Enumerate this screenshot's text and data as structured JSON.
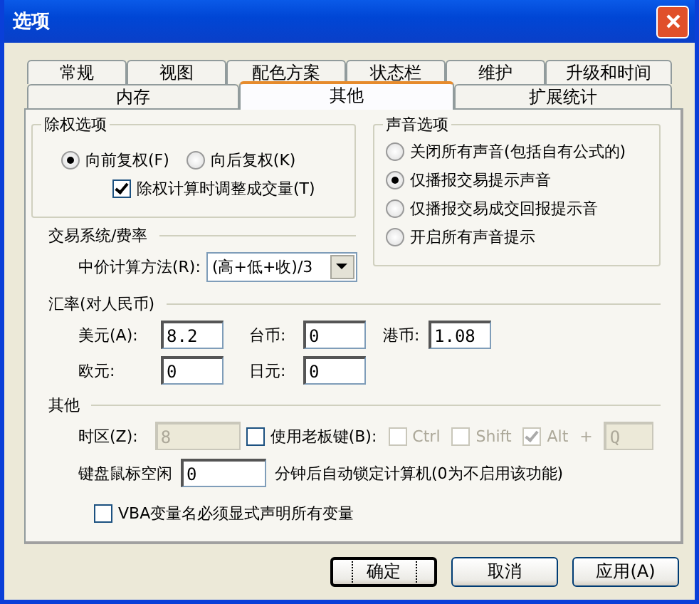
{
  "window": {
    "title": "选项"
  },
  "tab_rows": [
    [
      {
        "label": "常规",
        "selected": false
      },
      {
        "label": "视图",
        "selected": false
      },
      {
        "label": "配色方案",
        "selected": false
      },
      {
        "label": "状态栏",
        "selected": false
      },
      {
        "label": "维护",
        "selected": false
      },
      {
        "label": "升级和时间",
        "selected": false
      }
    ],
    [
      {
        "label": "内存",
        "selected": false
      },
      {
        "label": "其他",
        "selected": true
      },
      {
        "label": "扩展统计",
        "selected": false
      }
    ]
  ],
  "adjust_group": {
    "title": "除权选项",
    "radios": [
      {
        "label": "向前复权(F)",
        "selected": true
      },
      {
        "label": "向后复权(K)",
        "selected": false
      }
    ],
    "checkbox": {
      "label": "除权计算时调整成交量(T)",
      "checked": true
    }
  },
  "sound_group": {
    "title": "声音选项",
    "radios": [
      {
        "label": "关闭所有声音(包括自有公式的)",
        "selected": false
      },
      {
        "label": "仅播报交易提示声音",
        "selected": true
      },
      {
        "label": "仅播报交易成交回报提示音",
        "selected": false
      },
      {
        "label": "开启所有声音提示",
        "selected": false
      }
    ]
  },
  "trading": {
    "title": "交易系统/费率",
    "field_label": "中价计算方法(R):",
    "dropdown_value": "(高+低+收)/3"
  },
  "exchange": {
    "title": "汇率(对人民币)",
    "fields": [
      {
        "label": "美元(A):",
        "value": "8.2"
      },
      {
        "label": "台币:",
        "value": "0"
      },
      {
        "label": "港币:",
        "value": "1.08"
      },
      {
        "label": "欧元:",
        "value": "0"
      },
      {
        "label": "日元:",
        "value": "0"
      }
    ]
  },
  "other": {
    "title": "其他",
    "timezone": {
      "label": "时区(Z):",
      "value": "8",
      "disabled": true
    },
    "boss_key": {
      "label": "使用老板键(B):",
      "checked": false,
      "modifiers": [
        {
          "label": "Ctrl",
          "checked": false,
          "disabled": true
        },
        {
          "label": "Shift",
          "checked": false,
          "disabled": true
        },
        {
          "label": "Alt",
          "checked": true,
          "disabled": true
        }
      ],
      "plus": "+",
      "key": {
        "value": "Q",
        "disabled": true
      }
    },
    "idle": {
      "label": "键盘鼠标空闲",
      "value": "0",
      "suffix": "分钟后自动锁定计算机(0为不启用该功能)"
    },
    "vba": {
      "label": "VBA变量名必须显式声明所有变量",
      "checked": false
    }
  },
  "buttons": [
    {
      "label": "确定",
      "focused": true
    },
    {
      "label": "取消",
      "focused": false
    },
    {
      "label": "应用(A)",
      "focused": false
    }
  ]
}
